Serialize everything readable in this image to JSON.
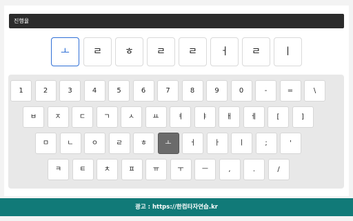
{
  "progress": {
    "label": "진행율"
  },
  "words": [
    {
      "text": "ㅗ",
      "active": true
    },
    {
      "text": "ㄹ",
      "active": false
    },
    {
      "text": "ㅎ",
      "active": false
    },
    {
      "text": "ㄹ",
      "active": false
    },
    {
      "text": "ㄹ",
      "active": false
    },
    {
      "text": "ㅓ",
      "active": false
    },
    {
      "text": "ㄹ",
      "active": false
    },
    {
      "text": "ㅣ",
      "active": false
    }
  ],
  "keyboard": {
    "rows": [
      [
        "1",
        "2",
        "3",
        "4",
        "5",
        "6",
        "7",
        "8",
        "9",
        "0",
        "-",
        "=",
        "\\"
      ],
      [
        "ㅂ",
        "ㅈ",
        "ㄷ",
        "ㄱ",
        "ㅅ",
        "ㅛ",
        "ㅕ",
        "ㅑ",
        "ㅐ",
        "ㅔ",
        "[",
        "]"
      ],
      [
        "ㅁ",
        "ㄴ",
        "ㅇ",
        "ㄹ",
        "ㅎ",
        "ㅗ",
        "ㅓ",
        "ㅏ",
        "ㅣ",
        ";",
        "'"
      ],
      [
        "ㅋ",
        "ㅌ",
        "ㅊ",
        "ㅍ",
        "ㅠ",
        "ㅜ",
        "ㅡ",
        ",",
        ".",
        "/"
      ]
    ],
    "pressed": {
      "row": 2,
      "col": 5
    }
  },
  "ad": {
    "label": "광고 :  https://한컴타자연습.kr"
  },
  "colors": {
    "accent": "#2f6fd6",
    "ad_bar": "#117a78",
    "progress_bar": "#2b2b2b",
    "pressed_key": "#6b6b6b"
  }
}
